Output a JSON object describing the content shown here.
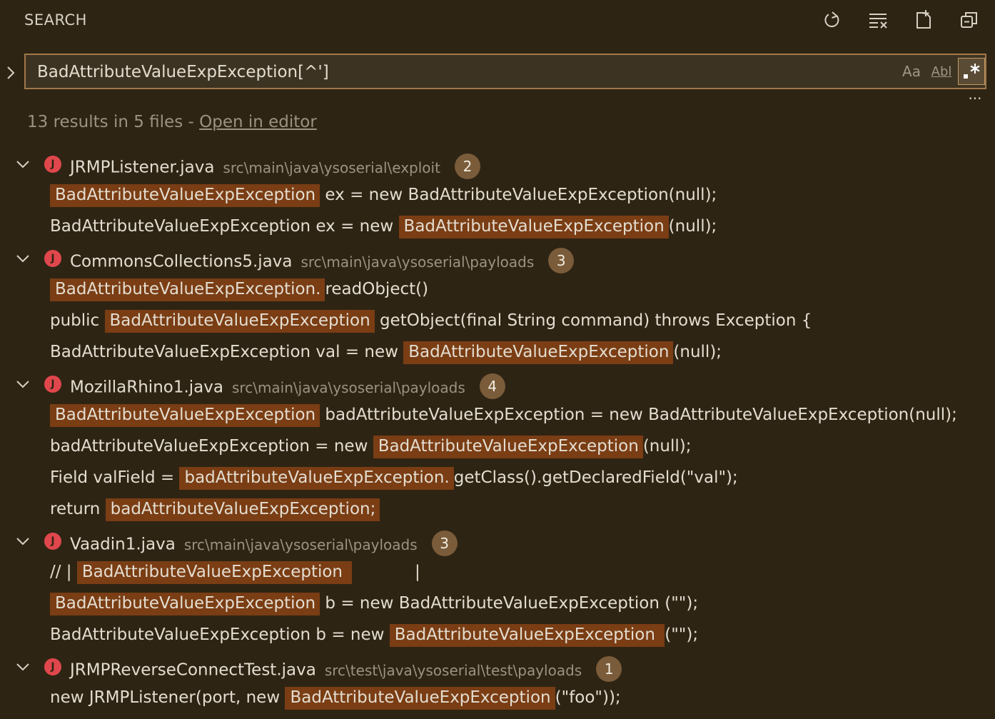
{
  "header": {
    "title": "SEARCH",
    "actions": [
      "refresh-icon",
      "clear-results-icon",
      "new-search-editor-icon",
      "collapse-all-icon"
    ]
  },
  "search": {
    "value": "BadAttributeValueExpException[^']",
    "match_case_label": "Aa",
    "whole_word_label": "Abl",
    "regex_label": ".*",
    "regex_active": true
  },
  "more_label": "···",
  "summary": {
    "text": "13 results in 5 files - ",
    "link": "Open in editor"
  },
  "colors": {
    "background": "#2e2414",
    "highlight": "#7a3d14",
    "badge": "#7a5c3a",
    "java_icon": "#e0474c",
    "input_border": "#a0784b"
  },
  "files": [
    {
      "name": "JRMPListener.java",
      "path": "src\\main\\java\\ysoserial\\exploit",
      "count": "2",
      "matches": [
        {
          "pre": "",
          "hl": "BadAttributeValueExpException",
          "post": " ex = new BadAttributeValueExpException(null);"
        },
        {
          "pre": "BadAttributeValueExpException ex = new ",
          "hl": "BadAttributeValueExpException",
          "post": "(null);"
        }
      ]
    },
    {
      "name": "CommonsCollections5.java",
      "path": "src\\main\\java\\ysoserial\\payloads",
      "count": "3",
      "matches": [
        {
          "pre": "",
          "hl": "BadAttributeValueExpException.",
          "post": "readObject()"
        },
        {
          "pre": "public ",
          "hl": "BadAttributeValueExpException",
          "post": " getObject(final String command) throws Exception {"
        },
        {
          "pre": "BadAttributeValueExpException val = new ",
          "hl": "BadAttributeValueExpException",
          "post": "(null);"
        }
      ]
    },
    {
      "name": "MozillaRhino1.java",
      "path": "src\\main\\java\\ysoserial\\payloads",
      "count": "4",
      "matches": [
        {
          "pre": "",
          "hl": "BadAttributeValueExpException",
          "post": " badAttributeValueExpException = new BadAttributeValueExpException(null);"
        },
        {
          "pre": "badAttributeValueExpException = new ",
          "hl": "BadAttributeValueExpException",
          "post": "(null);"
        },
        {
          "pre": "Field valField = ",
          "hl": "badAttributeValueExpException.",
          "post": "getClass().getDeclaredField(\"val\");"
        },
        {
          "pre": "return ",
          "hl": "badAttributeValueExpException;",
          "post": ""
        }
      ]
    },
    {
      "name": "Vaadin1.java",
      "path": "src\\main\\java\\ysoserial\\payloads",
      "count": "3",
      "matches": [
        {
          "pre": "// | ",
          "hl": "BadAttributeValueExpException ",
          "post": "            |"
        },
        {
          "pre": "",
          "hl": "BadAttributeValueExpException",
          "post": " b = new BadAttributeValueExpException (\"\");"
        },
        {
          "pre": "BadAttributeValueExpException b = new ",
          "hl": "BadAttributeValueExpException ",
          "post": "(\"\");"
        }
      ]
    },
    {
      "name": "JRMPReverseConnectTest.java",
      "path": "src\\test\\java\\ysoserial\\test\\payloads",
      "count": "1",
      "matches": [
        {
          "pre": "new JRMPListener(port, new ",
          "hl": "BadAttributeValueExpException",
          "post": "(\"foo\"));"
        }
      ]
    }
  ]
}
